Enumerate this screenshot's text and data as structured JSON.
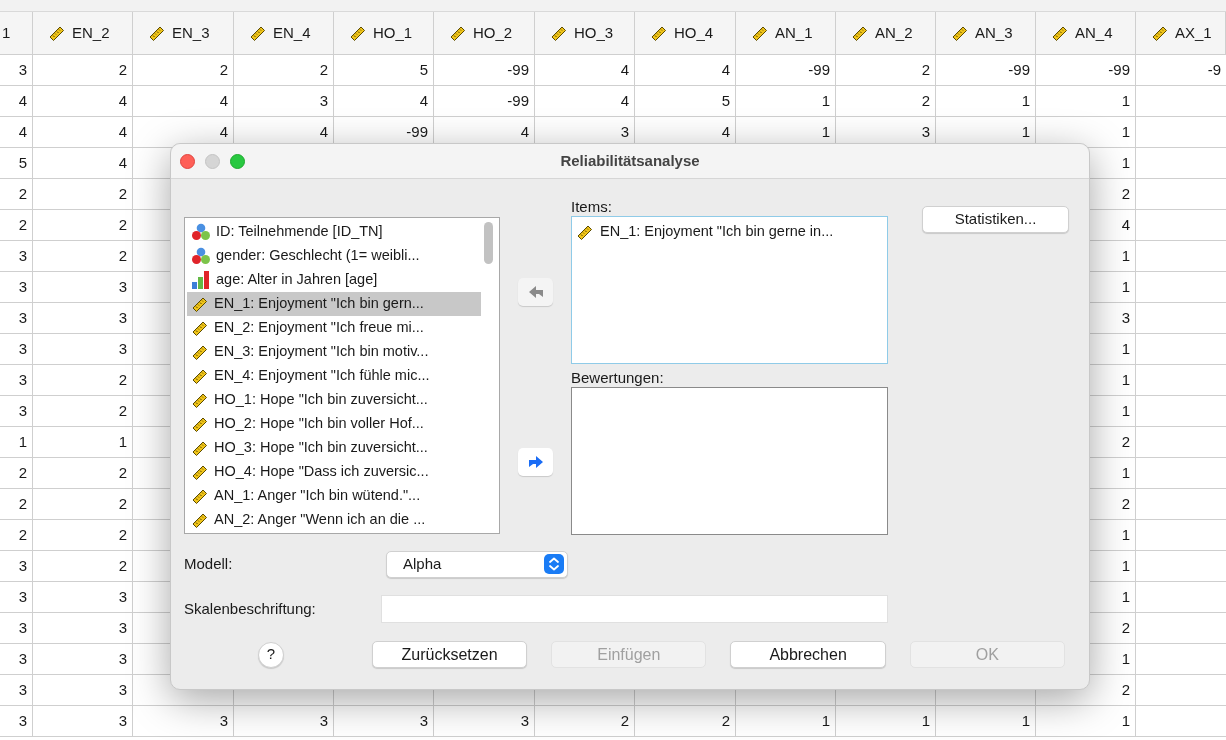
{
  "spreadsheet": {
    "columns": [
      "1",
      "EN_2",
      "EN_3",
      "EN_4",
      "HO_1",
      "HO_2",
      "HO_3",
      "HO_4",
      "AN_1",
      "AN_2",
      "AN_3",
      "AN_4",
      "AX_1"
    ],
    "rows": [
      [
        "3",
        "2",
        "2",
        "2",
        "5",
        "-99",
        "4",
        "4",
        "-99",
        "2",
        "-99",
        "-99",
        "-9"
      ],
      [
        "4",
        "4",
        "4",
        "3",
        "4",
        "-99",
        "4",
        "5",
        "1",
        "2",
        "1",
        "1",
        null
      ],
      [
        "4",
        "4",
        "4",
        "4",
        "-99",
        "4",
        "3",
        "4",
        "1",
        "3",
        "1",
        "1",
        null
      ],
      [
        "5",
        "4",
        null,
        null,
        null,
        null,
        null,
        null,
        null,
        null,
        null,
        "1",
        null
      ],
      [
        "2",
        "2",
        null,
        null,
        null,
        null,
        null,
        null,
        null,
        null,
        null,
        "2",
        null
      ],
      [
        "2",
        "2",
        null,
        null,
        null,
        null,
        null,
        null,
        null,
        null,
        null,
        "4",
        null
      ],
      [
        "3",
        "2",
        null,
        null,
        null,
        null,
        null,
        null,
        null,
        null,
        null,
        "1",
        null
      ],
      [
        "3",
        "3",
        null,
        null,
        null,
        null,
        null,
        null,
        null,
        null,
        null,
        "1",
        null
      ],
      [
        "3",
        "3",
        null,
        null,
        null,
        null,
        null,
        null,
        null,
        null,
        null,
        "3",
        null
      ],
      [
        "3",
        "3",
        null,
        null,
        null,
        null,
        null,
        null,
        null,
        null,
        null,
        "1",
        null
      ],
      [
        "3",
        "2",
        null,
        null,
        null,
        null,
        null,
        null,
        null,
        null,
        null,
        "1",
        null
      ],
      [
        "3",
        "2",
        null,
        null,
        null,
        null,
        null,
        null,
        null,
        null,
        null,
        "1",
        null
      ],
      [
        "1",
        "1",
        null,
        null,
        null,
        null,
        null,
        null,
        null,
        null,
        null,
        "2",
        null
      ],
      [
        "2",
        "2",
        null,
        null,
        null,
        null,
        null,
        null,
        null,
        null,
        null,
        "1",
        null
      ],
      [
        "2",
        "2",
        null,
        null,
        null,
        null,
        null,
        null,
        null,
        null,
        null,
        "2",
        null
      ],
      [
        "2",
        "2",
        null,
        null,
        null,
        null,
        null,
        null,
        null,
        null,
        null,
        "1",
        null
      ],
      [
        "3",
        "2",
        null,
        null,
        null,
        null,
        null,
        null,
        null,
        null,
        null,
        "1",
        null
      ],
      [
        "3",
        "3",
        null,
        null,
        null,
        null,
        null,
        null,
        null,
        null,
        null,
        "1",
        null
      ],
      [
        "3",
        "3",
        null,
        null,
        null,
        null,
        null,
        null,
        null,
        null,
        null,
        "2",
        null
      ],
      [
        "3",
        "3",
        null,
        null,
        null,
        null,
        null,
        null,
        null,
        null,
        null,
        "1",
        null
      ],
      [
        "3",
        "3",
        null,
        null,
        null,
        null,
        null,
        null,
        null,
        null,
        null,
        "2",
        null
      ],
      [
        "3",
        "3",
        "3",
        "3",
        "3",
        "3",
        "2",
        "2",
        "1",
        "1",
        "1",
        "1",
        null
      ]
    ]
  },
  "dialog": {
    "title": "Reliabilitätsanalyse",
    "variables": [
      {
        "label": "ID: Teilnehmende [ID_TN]",
        "kind": "nominal",
        "selected": false
      },
      {
        "label": "gender: Geschlecht (1= weibli...",
        "kind": "nominal",
        "selected": false
      },
      {
        "label": "age: Alter in Jahren [age]",
        "kind": "ordinal",
        "selected": false
      },
      {
        "label": "EN_1: Enjoyment \"Ich bin gern...",
        "kind": "scale",
        "selected": true
      },
      {
        "label": "EN_2: Enjoyment \"Ich freue mi...",
        "kind": "scale",
        "selected": false
      },
      {
        "label": "EN_3: Enjoyment \"Ich bin motiv...",
        "kind": "scale",
        "selected": false
      },
      {
        "label": "EN_4: Enjoyment \"Ich fühle mic...",
        "kind": "scale",
        "selected": false
      },
      {
        "label": "HO_1: Hope \"Ich bin zuversicht...",
        "kind": "scale",
        "selected": false
      },
      {
        "label": "HO_2: Hope \"Ich bin voller Hof...",
        "kind": "scale",
        "selected": false
      },
      {
        "label": "HO_3: Hope \"Ich bin zuversicht...",
        "kind": "scale",
        "selected": false
      },
      {
        "label": "HO_4: Hope \"Dass ich zuversic...",
        "kind": "scale",
        "selected": false
      },
      {
        "label": "AN_1: Anger  \"Ich bin wütend.\"...",
        "kind": "scale",
        "selected": false
      },
      {
        "label": "AN_2: Anger \"Wenn ich an die ...",
        "kind": "scale",
        "selected": false
      }
    ],
    "move_buttons": [
      {
        "kind": "left",
        "disabled": true
      },
      {
        "kind": "right",
        "disabled": false
      }
    ],
    "items_label": "Items:",
    "items": [
      {
        "label": "EN_1: Enjoyment \"Ich bin gerne in...",
        "kind": "scale"
      }
    ],
    "ratings_label": "Bewertungen:",
    "statistics_button": "Statistiken...",
    "model_label": "Modell:",
    "model_value": "Alpha",
    "scale_label_label": "Skalenbeschriftung:",
    "help": "?",
    "buttons": [
      {
        "label": "Zurücksetzen",
        "disabled": false
      },
      {
        "label": "Einfügen",
        "disabled": true
      },
      {
        "label": "Abbrechen",
        "disabled": false
      },
      {
        "label": "OK",
        "disabled": true
      }
    ]
  }
}
